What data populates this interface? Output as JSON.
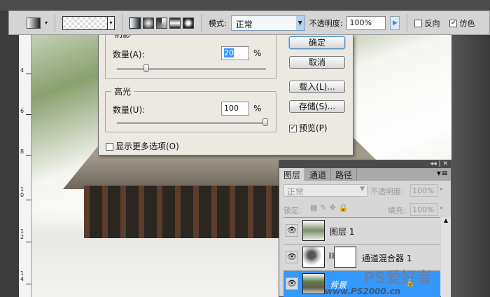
{
  "options_bar": {
    "mode_label": "模式:",
    "mode_value": "正常",
    "opacity_label": "不透明度:",
    "opacity_value": "100%",
    "reverse_label": "反向",
    "reverse_checked": false,
    "dither_label": "仿色",
    "dither_checked": true
  },
  "ruler_ticks": [
    "4",
    "6",
    "8",
    "10",
    "12",
    "14"
  ],
  "dialog": {
    "shadows_legend": "阴影",
    "shadows_amount_label": "数量(A):",
    "shadows_amount_value": "20",
    "shadows_amount_percent": 20,
    "highlights_legend": "高光",
    "highlights_amount_label": "数量(U):",
    "highlights_amount_value": "100",
    "highlights_amount_percent": 100,
    "percent": "%",
    "ok": "确定",
    "cancel": "取消",
    "load": "载入(L)...",
    "save": "存储(S)...",
    "preview_label": "预览(P)",
    "preview_checked": true,
    "more_options_label": "显示更多选项(O)",
    "more_options_checked": false
  },
  "layers_panel": {
    "tabs": [
      "图层",
      "通道",
      "路径"
    ],
    "blend_mode": "正常",
    "opacity_label": "不透明度:",
    "opacity_value": "100%",
    "lock_label": "锁定:",
    "fill_label": "填充:",
    "fill_value": "100%",
    "layers": [
      {
        "name": "图层 1",
        "selected": false
      },
      {
        "name": "通道混合器 1",
        "selected": false
      },
      {
        "name": "背景",
        "selected": true,
        "locked": true
      }
    ]
  },
  "watermark": {
    "text": "PS爱好者",
    "url": "www.PS2000.cn"
  },
  "colors": {
    "selection": "#3399ff",
    "accent": "#6aa8d8"
  }
}
